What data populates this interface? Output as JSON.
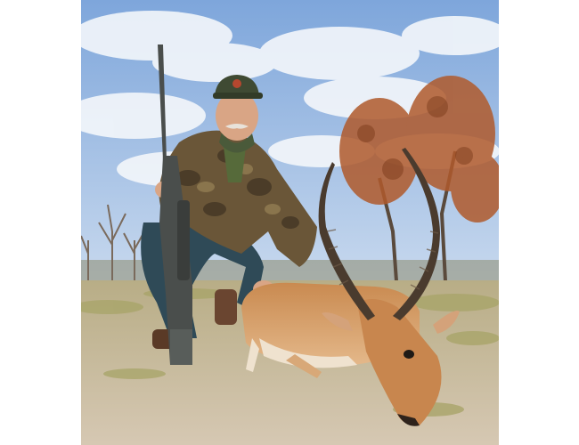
{
  "photo": {
    "alt": "",
    "colors": {
      "sky_top": "#7ea6db",
      "sky_bottom": "#c8d9ee",
      "cloud": "#f4f7fb",
      "ground": "#cdbfa8",
      "grass": "#a9a56a",
      "dry_trees": "#b05a2c",
      "impala_coat": "#c8864e",
      "impala_belly": "#efe2cf",
      "camo_jacket": "#6a5638",
      "jeans": "#2f4a57",
      "cap": "#3f4a33",
      "rifle": "#4a4e4c"
    }
  }
}
